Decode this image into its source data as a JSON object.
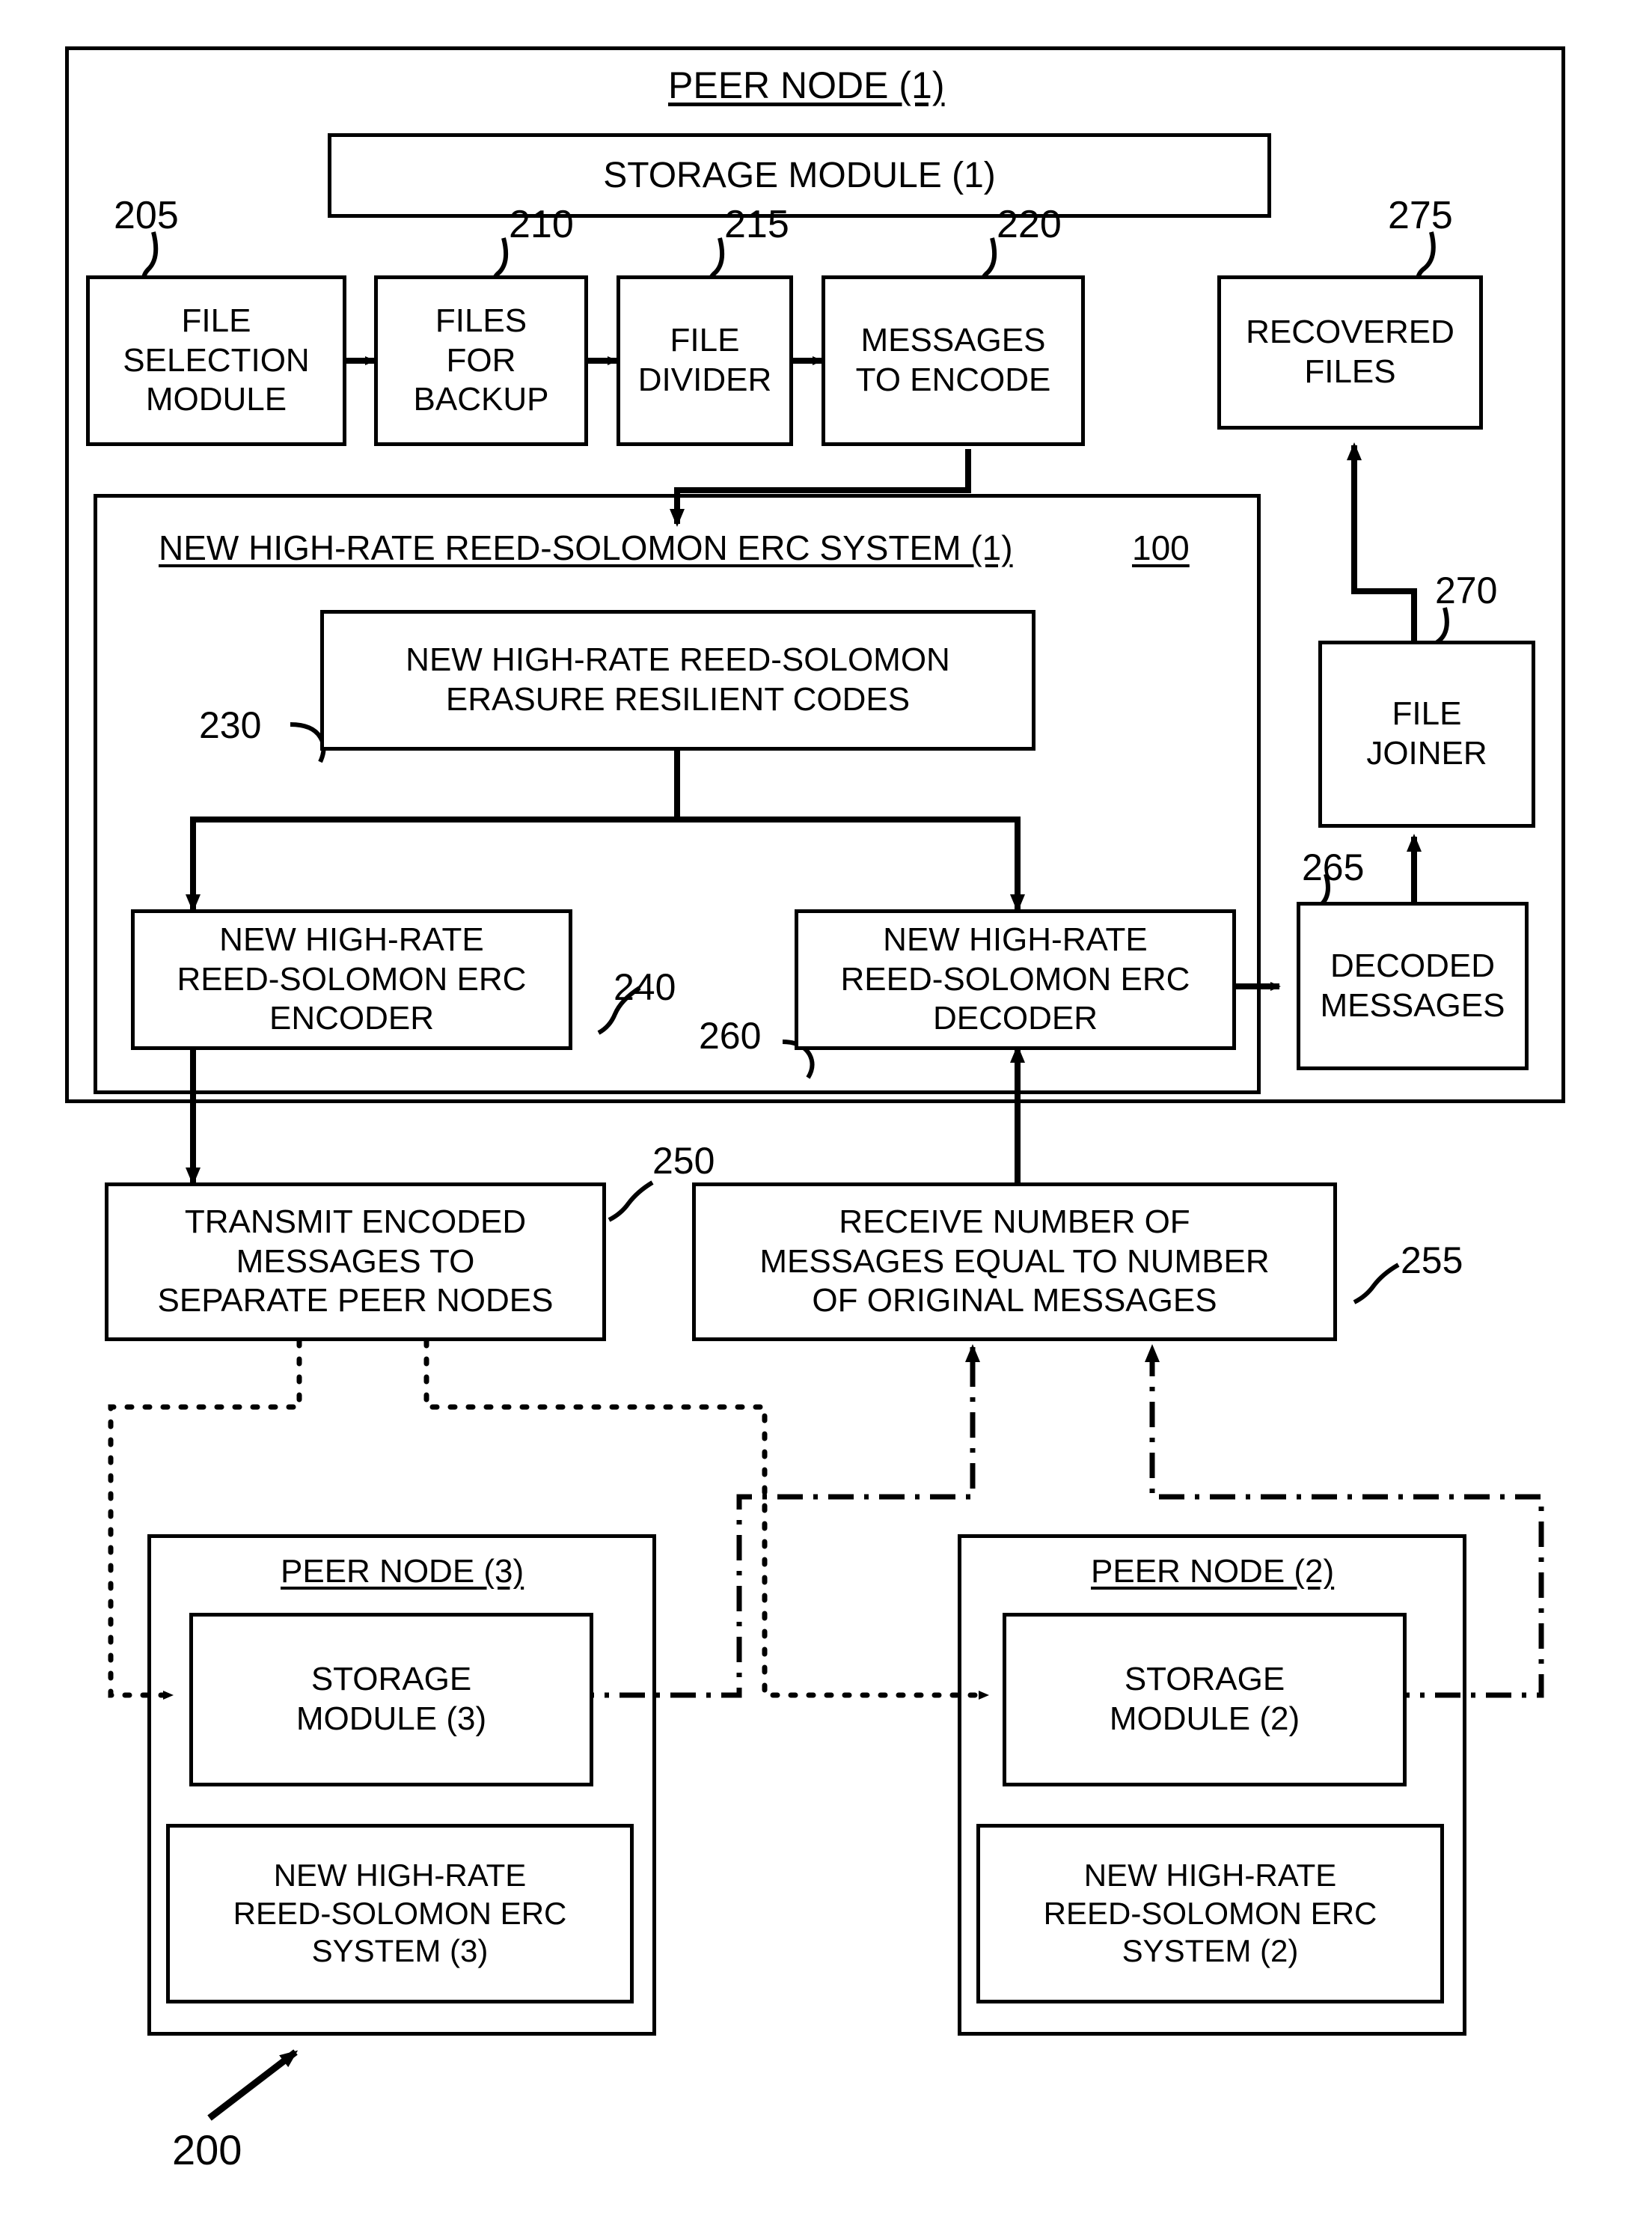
{
  "figure": {
    "ref_number": "200",
    "peer_node_1_title": "PEER NODE (1)",
    "peer_node_2_title": "PEER NODE (2)",
    "peer_node_3_title": "PEER NODE (3)"
  },
  "peer_node_1": {
    "title": "PEER NODE (1)",
    "storage_module": {
      "label": "STORAGE MODULE (1)"
    },
    "pipeline": [
      {
        "ref": "205",
        "label": "FILE\nSELECTION\nMODULE"
      },
      {
        "ref": "210",
        "label": "FILES\nFOR\nBACKUP"
      },
      {
        "ref": "215",
        "label": "FILE\nDIVIDER"
      },
      {
        "ref": "220",
        "label": "MESSAGES\nTO ENCODE"
      }
    ],
    "recovered_files": {
      "ref": "275",
      "label": "RECOVERED\nFILES"
    },
    "file_joiner": {
      "ref": "270",
      "label": "FILE\nJOINER"
    },
    "decoded_messages": {
      "ref": "265",
      "label": "DECODED\nMESSAGES"
    },
    "erc_system": {
      "title": "NEW HIGH-RATE REED-SOLOMON ERC SYSTEM (1)",
      "ref": "100",
      "codes_block": {
        "ref": "230",
        "label": "NEW HIGH-RATE REED-SOLOMON\nERASURE RESILIENT CODES"
      },
      "encoder": {
        "ref": "240",
        "label": "NEW HIGH-RATE\nREED-SOLOMON ERC\nENCODER"
      },
      "decoder": {
        "ref": "260",
        "label": "NEW HIGH-RATE\nREED-SOLOMON ERC\nDECODER"
      }
    },
    "transmit": {
      "ref": "250",
      "label": "TRANSMIT ENCODED\nMESSAGES TO\nSEPARATE PEER NODES"
    },
    "receive": {
      "ref": "255",
      "label": "RECEIVE NUMBER OF\nMESSAGES EQUAL TO NUMBER\nOF ORIGINAL MESSAGES"
    }
  },
  "peer_node_3": {
    "title": "PEER NODE (3)",
    "storage_module": {
      "label": "STORAGE\nMODULE (3)"
    },
    "erc_system": {
      "label": "NEW HIGH-RATE\nREED-SOLOMON ERC\nSYSTEM (3)"
    }
  },
  "peer_node_2": {
    "title": "PEER NODE (2)",
    "storage_module": {
      "label": "STORAGE\nMODULE (2)"
    },
    "erc_system": {
      "label": "NEW HIGH-RATE\nREED-SOLOMON ERC\nSYSTEM (2)"
    }
  },
  "colors": {
    "ink": "#000000",
    "paper": "#ffffff"
  }
}
